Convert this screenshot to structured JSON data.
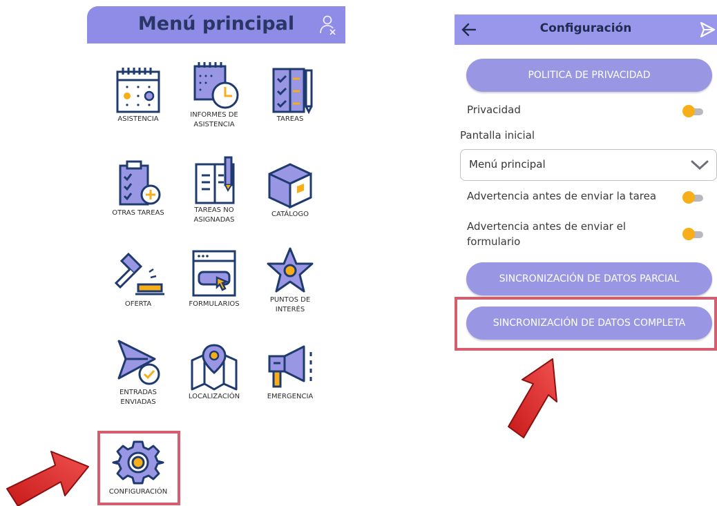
{
  "main_menu": {
    "title": "Menú principal",
    "tiles": [
      {
        "label": "ASISTENCIA",
        "icon": "calendar-icon"
      },
      {
        "label": "INFORMES DE\nASISTENCIA",
        "icon": "attendance-report-icon"
      },
      {
        "label": "TAREAS",
        "icon": "task-list-icon"
      },
      {
        "label": "OTRAS TAREAS",
        "icon": "clipboard-add-icon"
      },
      {
        "label": "TAREAS NO\nASIGNADAS",
        "icon": "notebook-pen-icon"
      },
      {
        "label": "CATÁLOGO",
        "icon": "box-icon"
      },
      {
        "label": "OFERTA",
        "icon": "gavel-icon"
      },
      {
        "label": "FORMULARIOS",
        "icon": "form-window-icon"
      },
      {
        "label": "PUNTOS DE\nINTERÉS",
        "icon": "star-pin-icon"
      },
      {
        "label": "ENTRADAS\nENVIADAS",
        "icon": "sent-check-icon"
      },
      {
        "label": "LOCALIZACIÓN",
        "icon": "map-pin-icon"
      },
      {
        "label": "EMERGENCIA",
        "icon": "megaphone-icon"
      },
      {
        "label": "CONFIGURACIÓN",
        "icon": "gear-icon"
      }
    ]
  },
  "settings": {
    "title": "Configuración",
    "privacy_policy_button": "POLITICA DE PRIVACIDAD",
    "privacy_label": "Privacidad",
    "home_screen_label": "Pantalla inicial",
    "home_screen_value": "Menú principal",
    "task_warning_label": "Advertencia antes de enviar la tarea",
    "form_warning_label": "Advertencia antes de enviar el formulario",
    "partial_sync_button": "SINCRONIZACIÓN DE DATOS PARCIAL",
    "full_sync_button": "SINCRONIZACIÓN DE DATOS COMPLETA"
  },
  "colors": {
    "header_purple": "#8e8ce6",
    "button_purple": "#9997e4",
    "toggle_orange": "#f7ae18",
    "icon_navy": "#1f3a6e",
    "highlight_red": "#d45e6e",
    "arrow_red": "#e02020"
  }
}
